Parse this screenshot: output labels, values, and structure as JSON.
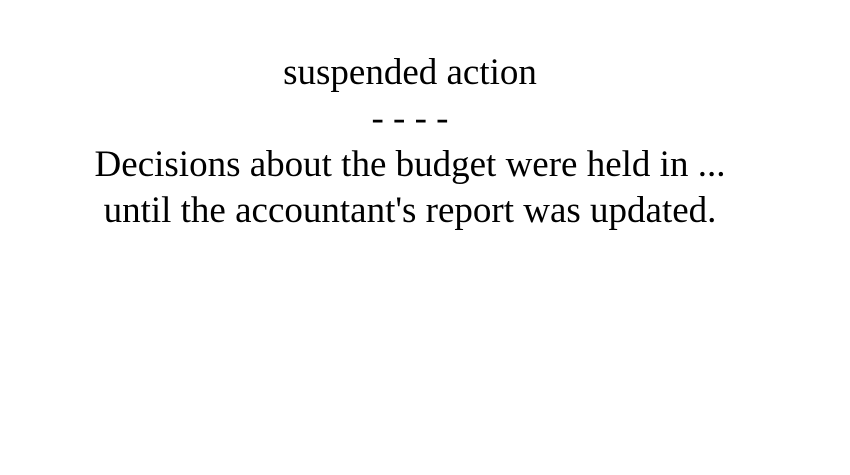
{
  "card": {
    "title": "suspended action",
    "separator": "- - - -",
    "sentence_line_1": "Decisions about the budget were held in ...",
    "sentence_line_2": "until the accountant's report was updated."
  }
}
